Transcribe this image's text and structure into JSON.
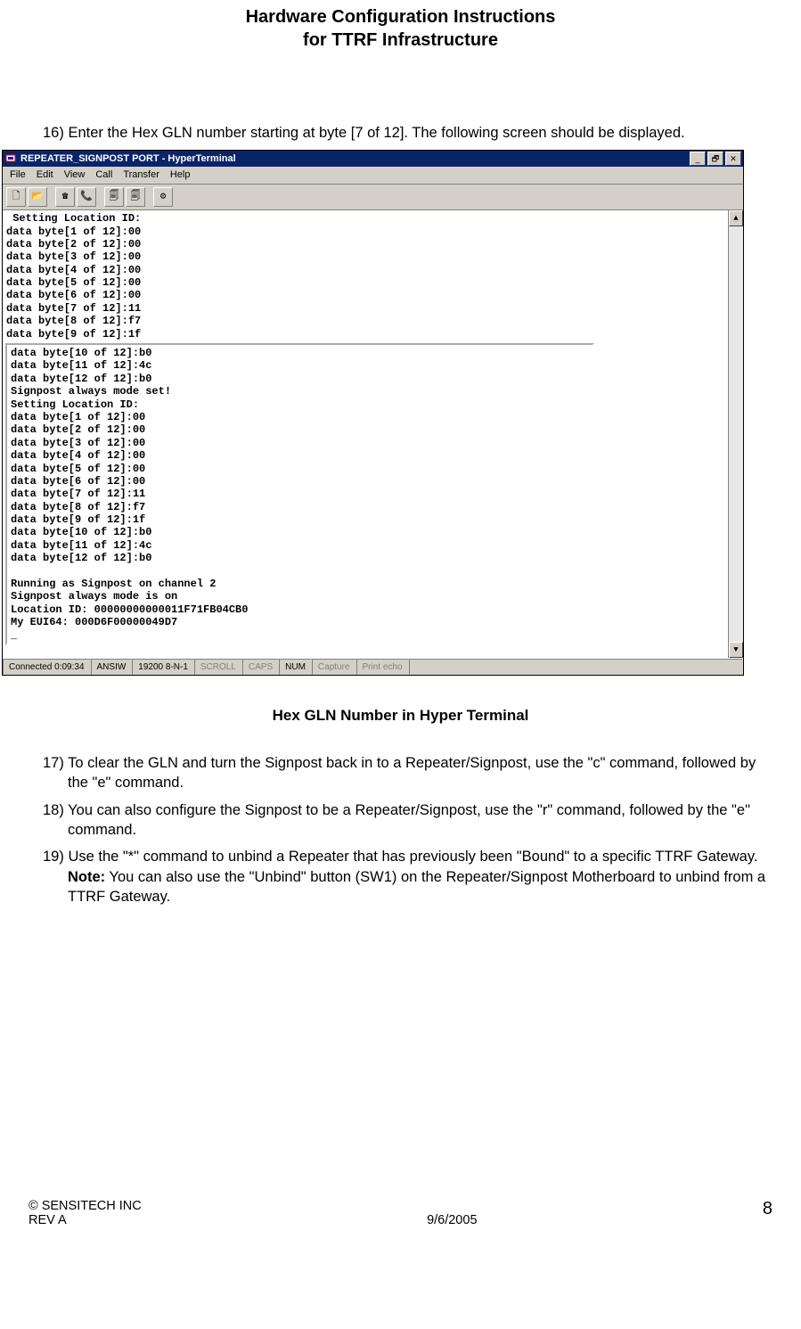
{
  "doc": {
    "title_l1": "Hardware Configuration Instructions",
    "title_l2": "for TTRF Infrastructure"
  },
  "steps": {
    "s16": {
      "num": "16)",
      "text": "Enter the Hex GLN number starting at byte [7 of 12]. The following screen should be displayed."
    },
    "s17": {
      "num": "17)",
      "text": "To clear the GLN and turn the Signpost back in to a Repeater/Signpost, use the \"c\" command, followed by the \"e\" command."
    },
    "s18": {
      "num": "18)",
      "text": "You can also configure the Signpost to be a Repeater/Signpost, use the \"r\" command, followed by the \"e\" command."
    },
    "s19": {
      "num": "19)",
      "pre": "Use the \"*\" command to unbind a Repeater that has previously been \"Bound\" to a specific TTRF Gateway.  ",
      "note": "Note:",
      "post": "  You can also use the \"Unbind\" button (SW1) on the Repeater/Signpost Motherboard to unbind from a TTRF Gateway."
    }
  },
  "caption": "Hex GLN Number in Hyper Terminal",
  "win": {
    "title": "REPEATER_SIGNPOST PORT - HyperTerminal",
    "menu": {
      "file": "File",
      "edit": "Edit",
      "view": "View",
      "call": "Call",
      "transfer": "Transfer",
      "help": "Help"
    },
    "toolbar_icons": {
      "new": "🗋",
      "open": "📂",
      "connect": "☎",
      "disconnect": "📞",
      "send": "🗐",
      "recv": "🗐",
      "props": "⚙"
    },
    "window_icons": {
      "min": "_",
      "restore": "🗗",
      "close": "✕"
    },
    "scroll": {
      "up": "▲",
      "down": "▼"
    },
    "statusbar": {
      "conn": "Connected 0:09:34",
      "emul": "ANSIW",
      "port": "19200 8-N-1",
      "scroll": "SCROLL",
      "caps": "CAPS",
      "num": "NUM",
      "capture": "Capture",
      "print": "Print echo"
    }
  },
  "terminal": {
    "top": " Setting Location ID:\ndata byte[1 of 12]:00\ndata byte[2 of 12]:00\ndata byte[3 of 12]:00\ndata byte[4 of 12]:00\ndata byte[5 of 12]:00\ndata byte[6 of 12]:00\ndata byte[7 of 12]:11\ndata byte[8 of 12]:f7\ndata byte[9 of 12]:1f",
    "bottom": "data byte[10 of 12]:b0\ndata byte[11 of 12]:4c\ndata byte[12 of 12]:b0\nSignpost always mode set!\nSetting Location ID:\ndata byte[1 of 12]:00\ndata byte[2 of 12]:00\ndata byte[3 of 12]:00\ndata byte[4 of 12]:00\ndata byte[5 of 12]:00\ndata byte[6 of 12]:00\ndata byte[7 of 12]:11\ndata byte[8 of 12]:f7\ndata byte[9 of 12]:1f\ndata byte[10 of 12]:b0\ndata byte[11 of 12]:4c\ndata byte[12 of 12]:b0\n\nRunning as Signpost on channel 2\nSignpost always mode is on\nLocation ID: 00000000000011F71FB04CB0\nMy EUI64: 000D6F00000049D7\n_"
  },
  "footer": {
    "left_l1": "© SENSITECH INC",
    "left_l2": "REV A",
    "center": "9/6/2005",
    "right": "8"
  }
}
